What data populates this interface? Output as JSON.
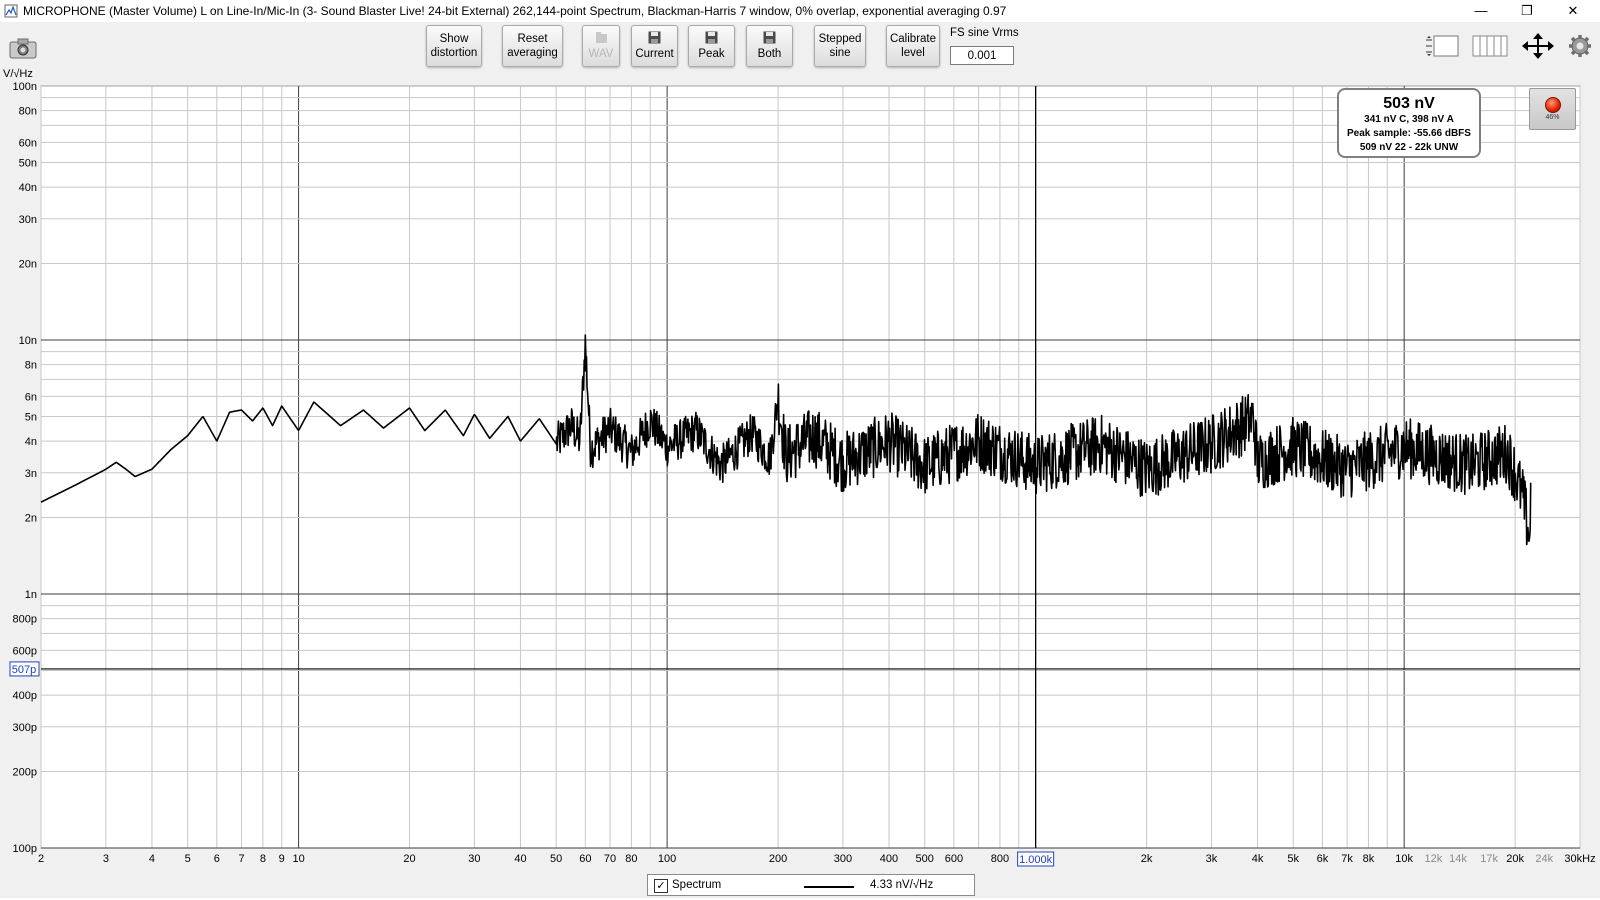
{
  "window": {
    "title": "MICROPHONE (Master Volume) L on Line-In/Mic-In (3- Sound Blaster Live! 24-bit External) 262,144-point Spectrum, Blackman-Harris 7 window, 0% overlap, exponential averaging 0.97",
    "minimize": "—",
    "restore": "❐",
    "close": "✕"
  },
  "toolbar": {
    "buttons": [
      {
        "line1": "Show",
        "line2": "distortion"
      },
      {
        "line1": "Reset",
        "line2": "averaging"
      },
      {
        "line1": "",
        "line2": "WAV"
      },
      {
        "line1": "",
        "line2": "Current"
      },
      {
        "line1": "",
        "line2": "Peak"
      },
      {
        "line1": "",
        "line2": "Both"
      },
      {
        "line1": "Stepped",
        "line2": "sine"
      },
      {
        "line1": "Calibrate",
        "line2": "level"
      }
    ],
    "fs_label": "FS sine Vrms",
    "fs_value": "0.001",
    "icons": [
      "camera-icon",
      "controls-icon",
      "panels-icon",
      "move-arrows-icon",
      "gear-icon"
    ]
  },
  "readout": {
    "main": "503 nV",
    "line1": "341 nV C, 398 nV A",
    "line2": "Peak sample: -55.66 dBFS",
    "line3": "509 nV 22 - 22k UNW"
  },
  "record": {
    "level": "46%",
    "color": "#e02000"
  },
  "legend": {
    "checked": "✓",
    "name": "Spectrum",
    "value": "4.33 nV/√Hz"
  },
  "chart_data": {
    "type": "line",
    "title": "",
    "xlabel": "",
    "ylabel": "V/√Hz",
    "x_scale": "log",
    "y_scale": "log",
    "xlim": [
      2,
      30000
    ],
    "ylim": [
      1e-10,
      1e-07
    ],
    "grid": true,
    "x_ticks": [
      {
        "v": 2,
        "label": "2"
      },
      {
        "v": 3,
        "label": "3"
      },
      {
        "v": 4,
        "label": "4"
      },
      {
        "v": 5,
        "label": "5"
      },
      {
        "v": 6,
        "label": "6"
      },
      {
        "v": 7,
        "label": "7"
      },
      {
        "v": 8,
        "label": "8"
      },
      {
        "v": 9,
        "label": "9"
      },
      {
        "v": 10,
        "label": "10"
      },
      {
        "v": 20,
        "label": "20"
      },
      {
        "v": 30,
        "label": "30"
      },
      {
        "v": 40,
        "label": "40"
      },
      {
        "v": 50,
        "label": "50"
      },
      {
        "v": 60,
        "label": "60"
      },
      {
        "v": 70,
        "label": "70"
      },
      {
        "v": 80,
        "label": "80"
      },
      {
        "v": 100,
        "label": "100"
      },
      {
        "v": 200,
        "label": "200"
      },
      {
        "v": 300,
        "label": "300"
      },
      {
        "v": 400,
        "label": "400"
      },
      {
        "v": 500,
        "label": "500"
      },
      {
        "v": 600,
        "label": "600"
      },
      {
        "v": 800,
        "label": "800"
      },
      {
        "v": 2000,
        "label": "2k"
      },
      {
        "v": 3000,
        "label": "3k"
      },
      {
        "v": 4000,
        "label": "4k"
      },
      {
        "v": 5000,
        "label": "5k"
      },
      {
        "v": 6000,
        "label": "6k"
      },
      {
        "v": 7000,
        "label": "7k"
      },
      {
        "v": 8000,
        "label": "8k"
      },
      {
        "v": 10000,
        "label": "10k"
      },
      {
        "v": 12000,
        "label": "12k",
        "dim": true
      },
      {
        "v": 14000,
        "label": "14k",
        "dim": true
      },
      {
        "v": 17000,
        "label": "17k",
        "dim": true
      },
      {
        "v": 20000,
        "label": "20k"
      },
      {
        "v": 24000,
        "label": "24k",
        "dim": true
      },
      {
        "v": 30000,
        "label": "30kHz"
      }
    ],
    "y_ticks": [
      {
        "v": 1e-07,
        "label": "100n"
      },
      {
        "v": 8e-08,
        "label": "80n"
      },
      {
        "v": 6e-08,
        "label": "60n"
      },
      {
        "v": 5e-08,
        "label": "50n"
      },
      {
        "v": 4e-08,
        "label": "40n"
      },
      {
        "v": 3e-08,
        "label": "30n"
      },
      {
        "v": 2e-08,
        "label": "20n"
      },
      {
        "v": 1e-08,
        "label": "10n"
      },
      {
        "v": 8e-09,
        "label": "8n"
      },
      {
        "v": 6e-09,
        "label": "6n"
      },
      {
        "v": 5e-09,
        "label": "5n"
      },
      {
        "v": 4e-09,
        "label": "4n"
      },
      {
        "v": 3e-09,
        "label": "3n"
      },
      {
        "v": 2e-09,
        "label": "2n"
      },
      {
        "v": 1e-09,
        "label": "1n"
      },
      {
        "v": 8e-10,
        "label": "800p"
      },
      {
        "v": 6e-10,
        "label": "600p"
      },
      {
        "v": 4e-10,
        "label": "400p"
      },
      {
        "v": 3e-10,
        "label": "300p"
      },
      {
        "v": 2e-10,
        "label": "200p"
      },
      {
        "v": 1e-10,
        "label": "100p"
      }
    ],
    "cursor": {
      "x": 1000,
      "x_label": "1.000k",
      "y": 5.07e-10,
      "y_label": "507p"
    },
    "series": [
      {
        "name": "Spectrum",
        "color": "#000000",
        "points": [
          [
            2,
            2.3e-09
          ],
          [
            2.5,
            2.7e-09
          ],
          [
            3,
            3.1e-09
          ],
          [
            3.2,
            3.3e-09
          ],
          [
            3.4,
            3.1e-09
          ],
          [
            3.6,
            2.9e-09
          ],
          [
            4,
            3.1e-09
          ],
          [
            4.5,
            3.7e-09
          ],
          [
            5,
            4.2e-09
          ],
          [
            5.5,
            5e-09
          ],
          [
            6,
            4e-09
          ],
          [
            6.5,
            5.2e-09
          ],
          [
            7,
            5.3e-09
          ],
          [
            7.5,
            4.8e-09
          ],
          [
            8,
            5.4e-09
          ],
          [
            8.5,
            4.6e-09
          ],
          [
            9,
            5.5e-09
          ],
          [
            9.5,
            4.9e-09
          ],
          [
            10,
            4.4e-09
          ],
          [
            11,
            5.7e-09
          ],
          [
            12,
            5.1e-09
          ],
          [
            13,
            4.6e-09
          ],
          [
            15,
            5.3e-09
          ],
          [
            17,
            4.5e-09
          ],
          [
            20,
            5.4e-09
          ],
          [
            22,
            4.4e-09
          ],
          [
            25,
            5.3e-09
          ],
          [
            28,
            4.2e-09
          ],
          [
            30,
            5.1e-09
          ],
          [
            33,
            4.1e-09
          ],
          [
            37,
            5e-09
          ],
          [
            40,
            4e-09
          ],
          [
            45,
            4.9e-09
          ],
          [
            50,
            3.9e-09
          ],
          [
            55,
            4.6e-09
          ],
          [
            58,
            4e-09
          ],
          [
            60,
            9.8e-09
          ],
          [
            62,
            3.7e-09
          ],
          [
            70,
            4.5e-09
          ],
          [
            80,
            3.6e-09
          ],
          [
            90,
            4.8e-09
          ],
          [
            100,
            3.8e-09
          ],
          [
            120,
            4.4e-09
          ],
          [
            140,
            3.2e-09
          ],
          [
            170,
            4.3e-09
          ],
          [
            190,
            3.4e-09
          ],
          [
            200,
            5.9e-09
          ],
          [
            210,
            3.5e-09
          ],
          [
            250,
            4.2e-09
          ],
          [
            300,
            3.3e-09
          ],
          [
            400,
            4e-09
          ],
          [
            500,
            3.2e-09
          ],
          [
            700,
            4e-09
          ],
          [
            1000,
            3.2e-09
          ],
          [
            1500,
            3.9e-09
          ],
          [
            2000,
            3.1e-09
          ],
          [
            3000,
            3.9e-09
          ],
          [
            3900,
            4.9e-09
          ],
          [
            4000,
            3.3e-09
          ],
          [
            5000,
            3.8e-09
          ],
          [
            7000,
            3.1e-09
          ],
          [
            10000,
            3.8e-09
          ],
          [
            15000,
            3.2e-09
          ],
          [
            19000,
            3.6e-09
          ],
          [
            20000,
            3e-09
          ],
          [
            21000,
            2.4e-09
          ],
          [
            22000,
            1.6e-09
          ],
          [
            22050,
            3.1e-09
          ]
        ]
      }
    ]
  }
}
